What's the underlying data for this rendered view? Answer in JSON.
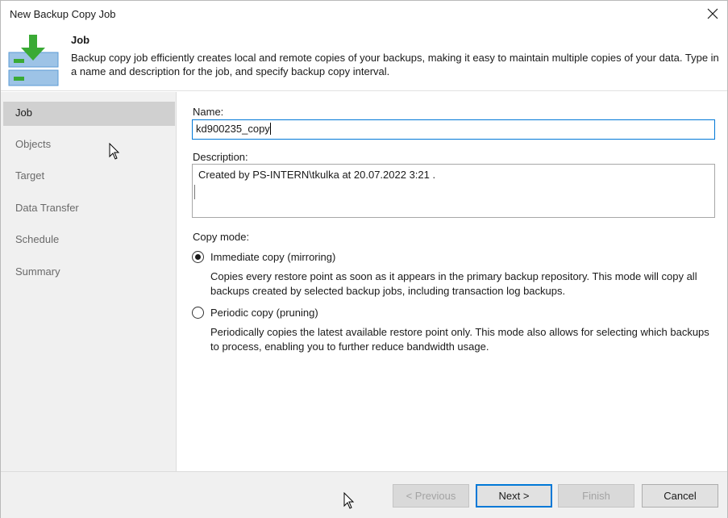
{
  "window": {
    "title": "New Backup Copy Job"
  },
  "header": {
    "title": "Job",
    "description": "Backup copy job efficiently creates local and remote copies of your backups, making it easy to maintain multiple copies of your data. Type in a name and description for the job, and specify backup copy interval."
  },
  "sidebar": {
    "items": [
      {
        "label": "Job",
        "active": true
      },
      {
        "label": "Objects",
        "active": false
      },
      {
        "label": "Target",
        "active": false
      },
      {
        "label": "Data Transfer",
        "active": false
      },
      {
        "label": "Schedule",
        "active": false
      },
      {
        "label": "Summary",
        "active": false
      }
    ]
  },
  "form": {
    "name_label": "Name:",
    "name_value": "kd900235_copy",
    "description_label": "Description:",
    "description_value": "Created by PS-INTERN\\tkulka at 20.07.2022 3:21 .",
    "copy_mode_label": "Copy mode:",
    "options": [
      {
        "label": "Immediate copy (mirroring)",
        "checked": true,
        "description": "Copies every restore point as soon as it appears in the primary backup repository. This mode will copy all backups created by selected backup jobs, including transaction log backups."
      },
      {
        "label": "Periodic copy (pruning)",
        "checked": false,
        "description": "Periodically copies the latest available restore point only. This mode also allows for selecting which backups to process, enabling you to further reduce bandwidth usage."
      }
    ]
  },
  "footer": {
    "previous_label": "< Previous",
    "next_label": "Next >",
    "finish_label": "Finish",
    "cancel_label": "Cancel"
  },
  "colors": {
    "accent": "#0078d7",
    "icon_green": "#3aaa35",
    "icon_blue": "#5b9bd5"
  }
}
